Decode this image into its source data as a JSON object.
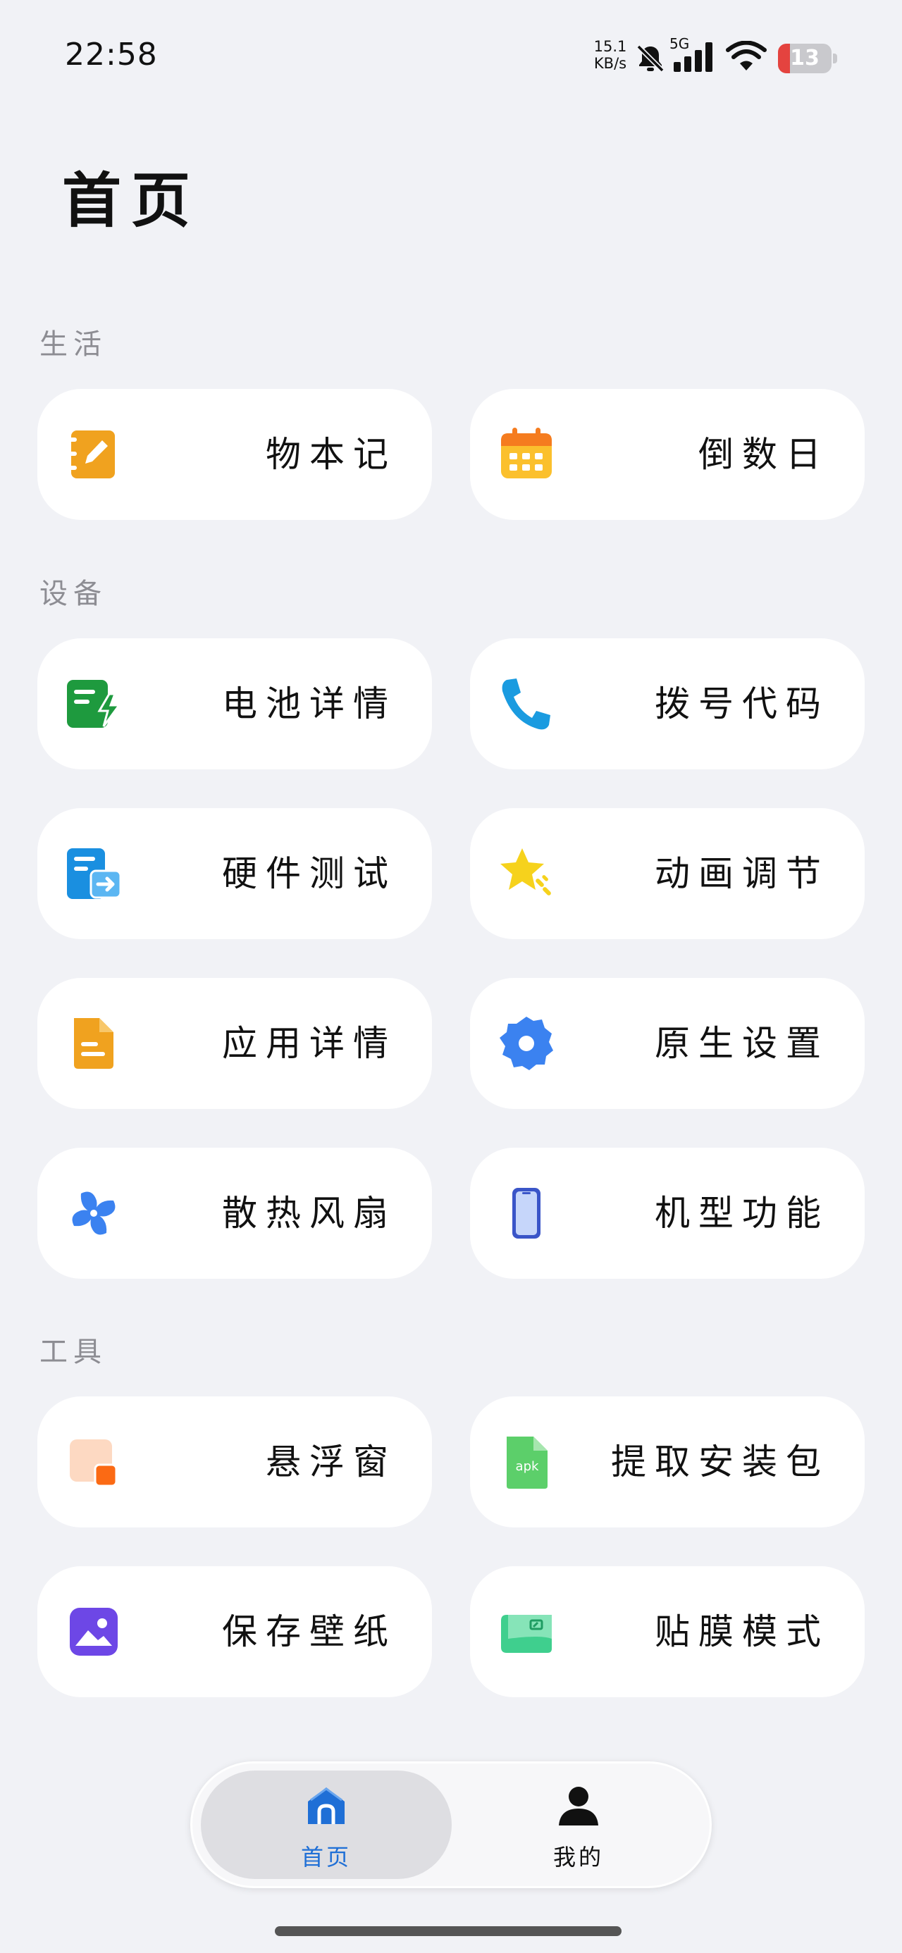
{
  "status": {
    "time": "22:58",
    "net_speed_value": "15.1",
    "net_speed_unit": "KB/s",
    "network": "5G",
    "battery": "13"
  },
  "page_title": "首页",
  "sections": {
    "life": {
      "title": "生活",
      "items": [
        {
          "label": "物本记",
          "icon": "notebook-icon"
        },
        {
          "label": "倒数日",
          "icon": "calendar-icon"
        }
      ]
    },
    "device": {
      "title": "设备",
      "items": [
        {
          "label": "电池详情",
          "icon": "battery-detail-icon"
        },
        {
          "label": "拨号代码",
          "icon": "phone-icon"
        },
        {
          "label": "硬件测试",
          "icon": "hardware-test-icon"
        },
        {
          "label": "动画调节",
          "icon": "star-icon"
        },
        {
          "label": "应用详情",
          "icon": "document-icon"
        },
        {
          "label": "原生设置",
          "icon": "gear-icon"
        },
        {
          "label": "散热风扇",
          "icon": "fan-icon"
        },
        {
          "label": "机型功能",
          "icon": "smartphone-icon"
        }
      ]
    },
    "tools": {
      "title": "工具",
      "items": [
        {
          "label": "悬浮窗",
          "icon": "floating-window-icon"
        },
        {
          "label": "提取安装包",
          "icon": "apk-file-icon"
        },
        {
          "label": "保存壁纸",
          "icon": "wallpaper-icon"
        },
        {
          "label": "贴膜模式",
          "icon": "screen-film-icon"
        }
      ]
    }
  },
  "apk_text": "apk",
  "nav": {
    "home_label": "首页",
    "mine_label": "我的"
  },
  "colors": {
    "accent": "#1f6fd6",
    "background": "#f1f2f6",
    "card": "#ffffff",
    "section_title": "#8d8d93"
  }
}
